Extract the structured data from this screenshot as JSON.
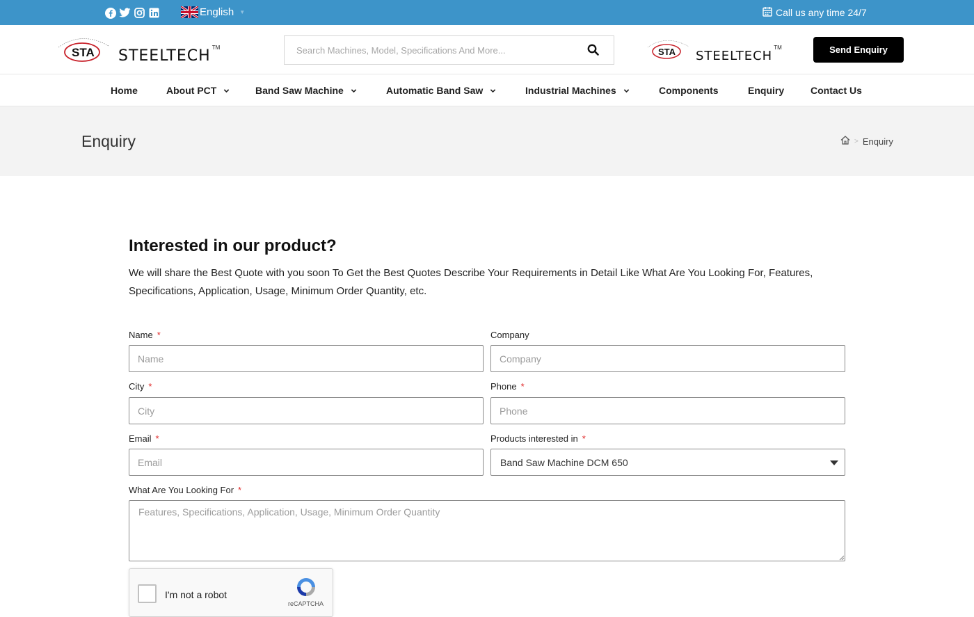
{
  "topbar": {
    "social": [
      "facebook-icon",
      "twitter-icon",
      "instagram-icon",
      "linkedin-icon"
    ],
    "language": "English",
    "call_text": "Call us any time 24/7",
    "bg_color": "#3d94c9"
  },
  "header": {
    "logo": {
      "badge": "STA",
      "brand": "STEELTECH",
      "tm": "TM"
    },
    "search_placeholder": "Search Machines, Model, Specifications And More...",
    "logo_right": {
      "badge": "STA",
      "brand": "STEELTECH",
      "tm": "TM"
    },
    "send_button": "Send Enquiry"
  },
  "nav": {
    "items": [
      {
        "label": "Home",
        "dropdown": false
      },
      {
        "label": "About PCT",
        "dropdown": true
      },
      {
        "label": "Band Saw Machine",
        "dropdown": true
      },
      {
        "label": "Automatic Band Saw",
        "dropdown": true
      },
      {
        "label": "Industrial Machines",
        "dropdown": true
      },
      {
        "label": "Components",
        "dropdown": false
      },
      {
        "label": "Enquiry",
        "dropdown": false
      },
      {
        "label": "Contact Us",
        "dropdown": false
      }
    ]
  },
  "page": {
    "title": "Enquiry",
    "breadcrumb_current": "Enquiry"
  },
  "content": {
    "heading": "Interested in our product?",
    "intro": "We will share the Best Quote with you soon To Get the Best Quotes Describe Your Requirements in Detail Like What Are You Looking For, Features, Specifications, Application, Usage, Minimum Order Quantity, etc."
  },
  "form": {
    "name": {
      "label": "Name",
      "required": "*",
      "placeholder": "Name"
    },
    "company": {
      "label": "Company",
      "placeholder": "Company"
    },
    "city": {
      "label": "City",
      "required": "*",
      "placeholder": "City"
    },
    "phone": {
      "label": "Phone",
      "required": "*",
      "placeholder": "Phone"
    },
    "email": {
      "label": "Email",
      "required": "*",
      "placeholder": "Email"
    },
    "products": {
      "label": "Products interested in",
      "required": "*",
      "selected": "Band Saw Machine DCM 650"
    },
    "looking_for": {
      "label": "What Are You Looking For",
      "required": "*",
      "placeholder": "Features, Specifications, Application, Usage, Minimum Order Quantity"
    },
    "recaptcha": {
      "label": "I'm not a robot",
      "brand": "reCAPTCHA"
    }
  }
}
